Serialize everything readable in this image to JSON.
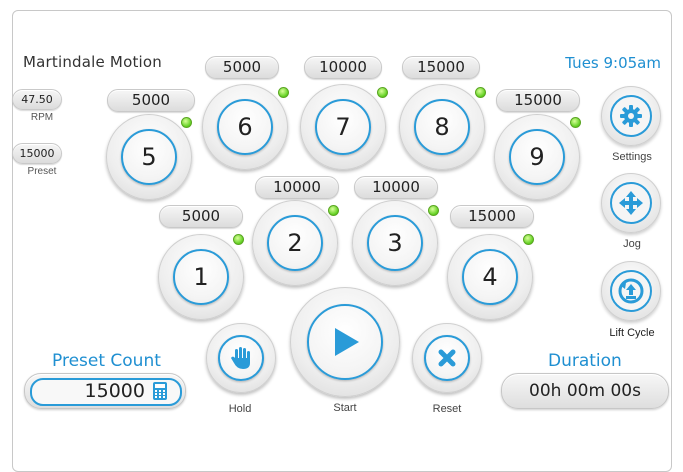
{
  "app": {
    "title": "Martindale Motion",
    "clock": "Tues  9:05am"
  },
  "readouts": {
    "rpm_value": "47.50",
    "rpm_label": "RPM",
    "preset_value": "15000",
    "preset_label": "Preset"
  },
  "stations": [
    {
      "number": "1",
      "count": "5000",
      "led": "green"
    },
    {
      "number": "2",
      "count": "10000",
      "led": "green"
    },
    {
      "number": "3",
      "count": "10000",
      "led": "green"
    },
    {
      "number": "4",
      "count": "15000",
      "led": "green"
    },
    {
      "number": "5",
      "count": "5000",
      "led": "green"
    },
    {
      "number": "6",
      "count": "5000",
      "led": "green"
    },
    {
      "number": "7",
      "count": "10000",
      "led": "green"
    },
    {
      "number": "8",
      "count": "15000",
      "led": "green"
    },
    {
      "number": "9",
      "count": "15000",
      "led": "green"
    }
  ],
  "side_buttons": {
    "settings": "Settings",
    "jog": "Jog",
    "lift_cycle": "Lift Cycle"
  },
  "controls": {
    "hold": "Hold",
    "start": "Start",
    "reset": "Reset"
  },
  "preset_count": {
    "label": "Preset Count",
    "value": "15000",
    "icon": "calculator-icon"
  },
  "duration": {
    "label": "Duration",
    "value": "00h 00m 00s"
  },
  "colors": {
    "accent": "#2a9bd8",
    "text_accent": "#1f8fd1",
    "led": "#5fcf1f"
  }
}
